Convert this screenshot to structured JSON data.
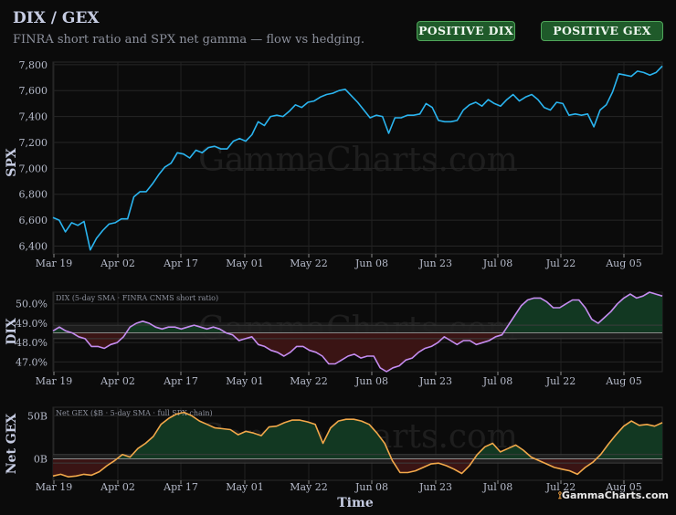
{
  "header": {
    "title": "DIX / GEX",
    "subtitle": "FINRA short ratio and SPX net gamma — flow vs hedging.",
    "badges": [
      "POSITIVE DIX",
      "POSITIVE GEX"
    ]
  },
  "watermark": "GammaCharts.com",
  "brand": "GammaCharts.com",
  "colors": {
    "background": "#0b0b0b",
    "spx_line": "#2ab4ef",
    "dix_line": "#c58cf0",
    "gex_line": "#f2a84a",
    "positive_fill": "#123822",
    "negative_fill": "#3a1414",
    "badge_bg": "#1f5a2a"
  },
  "chart_data": [
    {
      "type": "line",
      "name": "spx",
      "ylabel": "SPX",
      "ylim": [
        6340,
        7820
      ],
      "yticks": [
        6400,
        6600,
        6800,
        7000,
        7200,
        7400,
        7600,
        7800
      ],
      "ytick_labels": [
        "6,400",
        "6,600",
        "6,800",
        "7,000",
        "7,200",
        "7,400",
        "7,600",
        "7,800"
      ],
      "grid": true,
      "x_tick_labels": [
        "Mar 19",
        "Apr 02",
        "Apr 17",
        "May 01",
        "May 22",
        "Jun 08",
        "Jun 23",
        "Jul 08",
        "Jul 22",
        "Aug 05"
      ],
      "values": [
        6620,
        6600,
        6510,
        6580,
        6560,
        6590,
        6370,
        6460,
        6520,
        6570,
        6580,
        6610,
        6610,
        6780,
        6820,
        6820,
        6880,
        6950,
        7010,
        7040,
        7120,
        7110,
        7080,
        7140,
        7120,
        7160,
        7170,
        7150,
        7150,
        7210,
        7230,
        7210,
        7260,
        7360,
        7330,
        7400,
        7410,
        7400,
        7440,
        7490,
        7470,
        7510,
        7520,
        7550,
        7570,
        7580,
        7600,
        7610,
        7560,
        7510,
        7450,
        7390,
        7410,
        7400,
        7270,
        7390,
        7390,
        7410,
        7410,
        7420,
        7500,
        7470,
        7370,
        7360,
        7360,
        7370,
        7450,
        7490,
        7510,
        7480,
        7530,
        7500,
        7480,
        7530,
        7570,
        7520,
        7550,
        7570,
        7530,
        7470,
        7450,
        7510,
        7500,
        7410,
        7420,
        7410,
        7420,
        7320,
        7450,
        7490,
        7590,
        7730,
        7720,
        7710,
        7750,
        7740,
        7720,
        7740,
        7790
      ]
    },
    {
      "type": "area",
      "name": "dix",
      "ylabel": "DIX",
      "annotation": "DIX (5-day SMA · FINRA CNMS short ratio)",
      "ylim": [
        46.5,
        50.6
      ],
      "baseline": 48.5,
      "band": [
        48.2,
        48.9
      ],
      "yticks": [
        47.0,
        48.0,
        49.0,
        50.0
      ],
      "ytick_labels": [
        "47.0%",
        "48.0%",
        "49.0%",
        "50.0%"
      ],
      "grid": true,
      "x_tick_labels": [
        "Mar 19",
        "Apr 02",
        "Apr 17",
        "May 01",
        "May 22",
        "Jun 08",
        "Jun 23",
        "Jul 08",
        "Jul 22",
        "Aug 05"
      ],
      "values": [
        48.6,
        48.8,
        48.6,
        48.5,
        48.3,
        48.2,
        47.8,
        47.8,
        47.7,
        47.9,
        48.0,
        48.3,
        48.8,
        49.0,
        49.1,
        49.0,
        48.8,
        48.7,
        48.8,
        48.8,
        48.7,
        48.8,
        48.9,
        48.8,
        48.7,
        48.8,
        48.7,
        48.5,
        48.4,
        48.1,
        48.2,
        48.3,
        47.9,
        47.8,
        47.6,
        47.5,
        47.3,
        47.5,
        47.8,
        47.8,
        47.6,
        47.5,
        47.3,
        46.9,
        46.9,
        47.1,
        47.3,
        47.4,
        47.2,
        47.3,
        47.3,
        46.7,
        46.5,
        46.7,
        46.8,
        47.1,
        47.2,
        47.5,
        47.7,
        47.8,
        48.0,
        48.3,
        48.1,
        47.9,
        48.1,
        48.1,
        47.9,
        48.0,
        48.1,
        48.3,
        48.4,
        48.9,
        49.4,
        49.9,
        50.2,
        50.3,
        50.3,
        50.1,
        49.8,
        49.8,
        50.0,
        50.2,
        50.2,
        49.8,
        49.2,
        49.0,
        49.3,
        49.6,
        50.0,
        50.3,
        50.5,
        50.3,
        50.4,
        50.6,
        50.5,
        50.4
      ]
    },
    {
      "type": "area",
      "name": "gex",
      "ylabel": "Net GEX",
      "xlabel": "Time",
      "annotation": "Net GEX ($B · 5-day SMA · full SPX chain)",
      "ylim": [
        -25,
        60
      ],
      "baseline": 0,
      "band": [
        -5,
        5
      ],
      "yticks": [
        0,
        50
      ],
      "ytick_labels": [
        "0B",
        "50B"
      ],
      "grid": true,
      "x_tick_labels": [
        "Mar 19",
        "Apr 02",
        "Apr 17",
        "May 01",
        "May 22",
        "Jun 08",
        "Jun 23",
        "Jul 08",
        "Jul 22",
        "Aug 05"
      ],
      "values": [
        -20,
        -18,
        -21,
        -20,
        -18,
        -19,
        -15,
        -8,
        -2,
        5,
        2,
        12,
        18,
        26,
        40,
        47,
        52,
        54,
        50,
        44,
        40,
        36,
        35,
        34,
        28,
        32,
        30,
        27,
        37,
        38,
        42,
        45,
        45,
        43,
        40,
        18,
        36,
        44,
        46,
        46,
        44,
        40,
        30,
        18,
        -2,
        -16,
        -16,
        -14,
        -10,
        -6,
        -5,
        -8,
        -12,
        -17,
        -8,
        5,
        14,
        18,
        8,
        12,
        16,
        10,
        2,
        -2,
        -6,
        -10,
        -12,
        -14,
        -18,
        -10,
        -4,
        5,
        17,
        28,
        38,
        44,
        39,
        40,
        38,
        42
      ]
    }
  ]
}
